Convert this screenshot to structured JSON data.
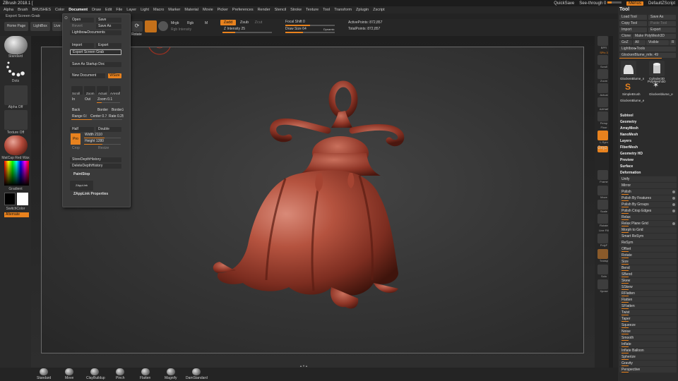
{
  "titlebar": {
    "title": "ZBrush 2018.1 [",
    "quicksave": "QuickSave",
    "seethrough": "See-through   0",
    "menus": "Menus",
    "defaultscript": "DefaultZScript"
  },
  "menubar": [
    "Alpha",
    "Brush",
    "BRUSHES",
    "Color",
    "Document",
    "Draw",
    "Edit",
    "File",
    "Layer",
    "Light",
    "Macro",
    "Marker",
    "Material",
    "Movie",
    "Picker",
    "Preferences",
    "Render",
    "Stencil",
    "Stroke",
    "Texture",
    "Tool",
    "Transform",
    "Zplugin",
    "Zscript"
  ],
  "selected_menu": "Document",
  "subbar": "Export Screen Grab",
  "shelf": {
    "home": "Home Page",
    "lightbox": "LightBox",
    "liveboolean": "Live Boo",
    "rotate": "Rotate",
    "mrgb": "Mrgb",
    "rgb": "Rgb",
    "m": "M",
    "zadd": "Zadd",
    "zsub": "Zsub",
    "zcut": "Zcut",
    "rgb_intensity": "Rgb Intensity",
    "z_intensity": "Z Intensity 25",
    "z_intensity_fill": 0.25,
    "focal_shift": "Focal Shift 0",
    "focal_fill": 0.5,
    "draw_size": "Draw Size 64",
    "draw_fill": 0.35,
    "dynamic": "Dynamic",
    "active_points": "ActivePoints: 872,857",
    "total_points": "TotalPoints: 872,857"
  },
  "lefttray": {
    "standard": "Standard",
    "dots": "Dots",
    "alpha_off": "Alpha Off",
    "texture_off": "Texture Off",
    "matcap": "MatCap Red Wax",
    "gradient": "Gradient",
    "switchcolor": "SwitchColor",
    "alternate": "Alternate"
  },
  "doc_menu": {
    "open": "Open",
    "save": "Save",
    "revert": "Revert",
    "save_as": "Save As",
    "lightbox_docs": "Lightbox▸Documents",
    "import": "Import",
    "export": "Export",
    "export_screen_grab": "Export Screen Grab",
    "save_startup": "Save As Startup Doc",
    "new_document": "New Document",
    "wsize": "WSize",
    "icons": [
      "Scroll",
      "Zoom",
      "Actual",
      "AAHalf"
    ],
    "in": "In",
    "out": "Out",
    "zoom": "Zoom 0.1",
    "back": "Back",
    "border": "Border",
    "border2": "Border2",
    "range": "Range 0.5",
    "center": "Center 0.7",
    "rate": "Rate 0.25",
    "half": "Half",
    "double": "Double",
    "pro": "Pro",
    "width": "Width 2110",
    "height": "Height 1280",
    "crop": "Crop",
    "resize": "Resize",
    "store_depth": "StoreDepthHistory",
    "delete_depth": "DeleteDepthHistory",
    "paintstop": "PaintStop",
    "zapplink": "ZAppLink",
    "zapplink_props": "ZAppLink Properties"
  },
  "right_tray": [
    "BPR",
    "SPix 3",
    "Scroll",
    "Zoom",
    "Actual",
    "AAHalf",
    "Persp",
    "Floor",
    "L.Sym",
    "Gxyz",
    "Frame",
    "Move",
    "Scale",
    "Rotate",
    "Line Fill",
    "PolyF",
    "Transp",
    "Solo",
    "Xpose"
  ],
  "tool_panel": {
    "title": "Tool",
    "load": "Load Tool",
    "save_as": "Save As",
    "copy": "Copy Tool",
    "paste": "Paste Tool",
    "import": "Import",
    "export": "Export",
    "clone": "Clone",
    "make_polymesh": "Make PolyMesh3D",
    "goz": "GoZ",
    "all": "All",
    "visible": "Visible",
    "r": "R",
    "lightbox_tools": "Lightbox▸Tools",
    "current_tool": "GlockenBlume_mfe. 49",
    "tools": [
      "GlockenBlume_n",
      "Cylinder3D",
      "SimpleBrush",
      "PolyMesh3D",
      "GlockenBlume_e",
      "Glockenblume_e"
    ],
    "sections": [
      "Subtool",
      "Geometry",
      "ArrayMesh",
      "NanoMesh",
      "Layers",
      "FiberMesh",
      "Geometry HD",
      "Preview",
      "Surface",
      "Deformation"
    ],
    "deform_items": [
      "Unify",
      "Mirror",
      "Polish",
      "Polish By Features",
      "Polish By Groups",
      "Polish Crisp Edges",
      "Relax",
      "Relax Plane Grid",
      "Morph to Grid",
      "Smart ReSym",
      "ReSym",
      "Offset",
      "Rotate",
      "Size",
      "Bend",
      "SBend",
      "Skew",
      "SSkew",
      "RFlatten",
      "Flatten",
      "SFlatten",
      "Twist",
      "Taper",
      "Squeeze",
      "Noise",
      "Smooth",
      "Inflate",
      "Inflate Balloon",
      "Spherize",
      "Gravity",
      "Perspective"
    ]
  },
  "bottom_brushes": [
    "Standard",
    "Move",
    "ClayBuildup",
    "Pinch",
    "Flatten",
    "Magnify",
    "DamStandard"
  ]
}
